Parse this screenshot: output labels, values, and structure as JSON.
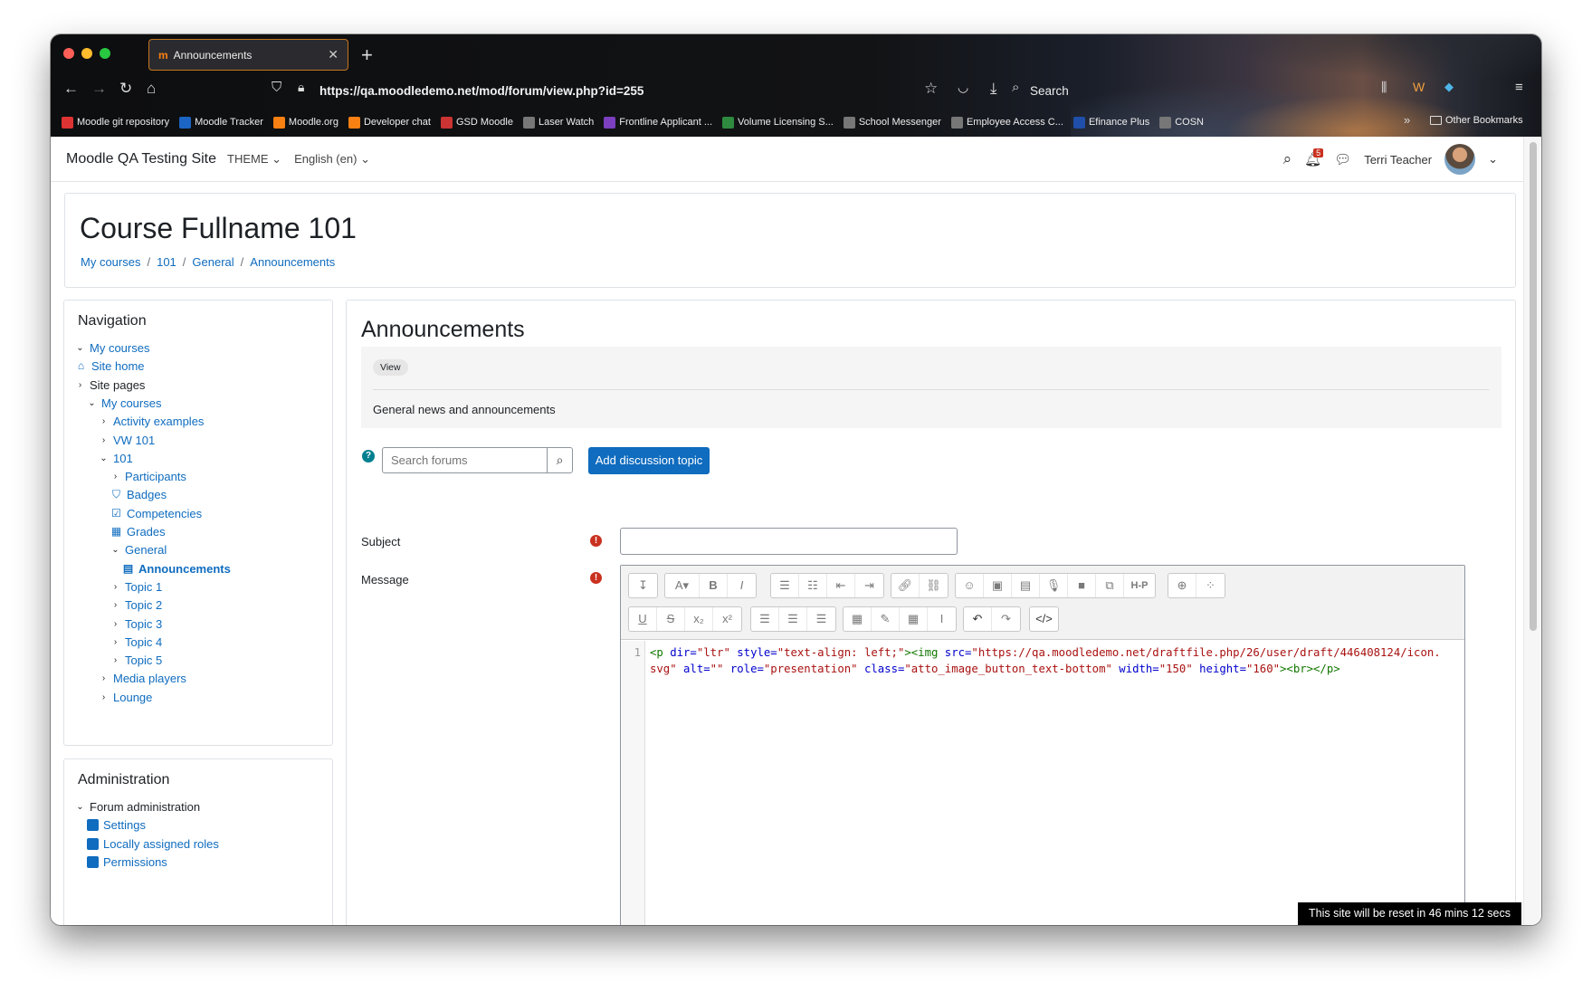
{
  "browser": {
    "tab_title": "Announcements",
    "url": "https://qa.moodledemo.net/mod/forum/view.php?id=255",
    "search_label": "Search",
    "bookmarks": [
      {
        "label": "Moodle git repository",
        "color": "#d33"
      },
      {
        "label": "Moodle Tracker",
        "color": "#1c65c4"
      },
      {
        "label": "Moodle.org",
        "color": "#f98012"
      },
      {
        "label": "Developer chat",
        "color": "#f98012"
      },
      {
        "label": "GSD Moodle",
        "color": "#c33"
      },
      {
        "label": "Laser Watch",
        "color": "#777"
      },
      {
        "label": "Frontline Applicant ...",
        "color": "#7b3fbf"
      },
      {
        "label": "Volume Licensing S...",
        "color": "#2d8a3e"
      },
      {
        "label": "School Messenger",
        "color": "#777"
      },
      {
        "label": "Employee Access C...",
        "color": "#777"
      },
      {
        "label": "Efinance Plus",
        "color": "#1f4fa8"
      },
      {
        "label": "COSN",
        "color": "#777"
      }
    ],
    "other_bookmarks": "Other Bookmarks"
  },
  "navbar": {
    "site_name": "Moodle QA Testing Site",
    "theme": "THEME",
    "language": "English (en)",
    "notification_count": "5",
    "user_name": "Terri Teacher"
  },
  "header": {
    "course_title": "Course Fullname 101",
    "breadcrumb": [
      "My courses",
      "101",
      "General",
      "Announcements"
    ]
  },
  "navigation": {
    "title": "Navigation",
    "items": [
      {
        "label": "My courses",
        "level": 0,
        "caret": "⌄",
        "icon": "",
        "style": "link"
      },
      {
        "label": "Site home",
        "level": 0,
        "caret": "",
        "icon": "home",
        "style": "link"
      },
      {
        "label": "Site pages",
        "level": 0,
        "caret": "›",
        "icon": "",
        "style": "dark"
      },
      {
        "label": "My courses",
        "level": 1,
        "caret": "⌄",
        "icon": "",
        "style": "link"
      },
      {
        "label": "Activity examples",
        "level": 2,
        "caret": "›",
        "icon": "",
        "style": "link"
      },
      {
        "label": "VW 101",
        "level": 2,
        "caret": "›",
        "icon": "",
        "style": "link"
      },
      {
        "label": "101",
        "level": 2,
        "caret": "⌄",
        "icon": "",
        "style": "link"
      },
      {
        "label": "Participants",
        "level": 3,
        "caret": "›",
        "icon": "",
        "style": "link"
      },
      {
        "label": "Badges",
        "level": 3,
        "caret": "",
        "icon": "shield",
        "style": "link"
      },
      {
        "label": "Competencies",
        "level": 3,
        "caret": "",
        "icon": "check",
        "style": "link"
      },
      {
        "label": "Grades",
        "level": 3,
        "caret": "",
        "icon": "table",
        "style": "link"
      },
      {
        "label": "General",
        "level": 3,
        "caret": "⌄",
        "icon": "",
        "style": "link"
      },
      {
        "label": "Announcements",
        "level": 4,
        "caret": "",
        "icon": "forum",
        "style": "bold"
      },
      {
        "label": "Topic 1",
        "level": 3,
        "caret": "›",
        "icon": "",
        "style": "link"
      },
      {
        "label": "Topic 2",
        "level": 3,
        "caret": "›",
        "icon": "",
        "style": "link"
      },
      {
        "label": "Topic 3",
        "level": 3,
        "caret": "›",
        "icon": "",
        "style": "link"
      },
      {
        "label": "Topic 4",
        "level": 3,
        "caret": "›",
        "icon": "",
        "style": "link"
      },
      {
        "label": "Topic 5",
        "level": 3,
        "caret": "›",
        "icon": "",
        "style": "link"
      },
      {
        "label": "Media players",
        "level": 2,
        "caret": "›",
        "icon": "",
        "style": "link"
      },
      {
        "label": "Lounge",
        "level": 2,
        "caret": "›",
        "icon": "",
        "style": "link"
      }
    ]
  },
  "administration": {
    "title": "Administration",
    "items": [
      {
        "label": "Forum administration",
        "level": 0,
        "caret": "⌄",
        "icon": "",
        "style": "dark"
      },
      {
        "label": "Settings",
        "level": 1,
        "caret": "",
        "icon": "square",
        "style": "link"
      },
      {
        "label": "Locally assigned roles",
        "level": 1,
        "caret": "",
        "icon": "square",
        "style": "link"
      },
      {
        "label": "Permissions",
        "level": 1,
        "caret": "",
        "icon": "square",
        "style": "link"
      }
    ]
  },
  "main": {
    "title": "Announcements",
    "view_pill": "View",
    "description": "General news and announcements",
    "search_placeholder": "Search forums",
    "add_button": "Add discussion topic",
    "subject_label": "Subject",
    "message_label": "Message",
    "line_number": "1",
    "code": {
      "p_open": "<p ",
      "dir_attr": "dir=",
      "dir_val": "\"ltr\"",
      "style_attr": " style=",
      "style_val": "\"text-align: left;\"",
      "img_open": "><img ",
      "src_attr": "src=",
      "src_val": "\"https://qa.moodledemo.net/draftfile.php/26/user/draft/446408124/icon.svg\"",
      "alt_attr": " alt=",
      "alt_val": "\"\"",
      "role_attr": " role=",
      "role_val": "\"presentation\"",
      "class_attr": " class=",
      "class_val": "\"atto_image_button_text-bottom\"",
      "width_attr": " width=",
      "width_val": "\"150\"",
      "height_attr": " height=",
      "height_val": "\"160\"",
      "close": "><br></p>"
    }
  },
  "reset_notice": "This site will be reset in 46 mins 12 secs"
}
